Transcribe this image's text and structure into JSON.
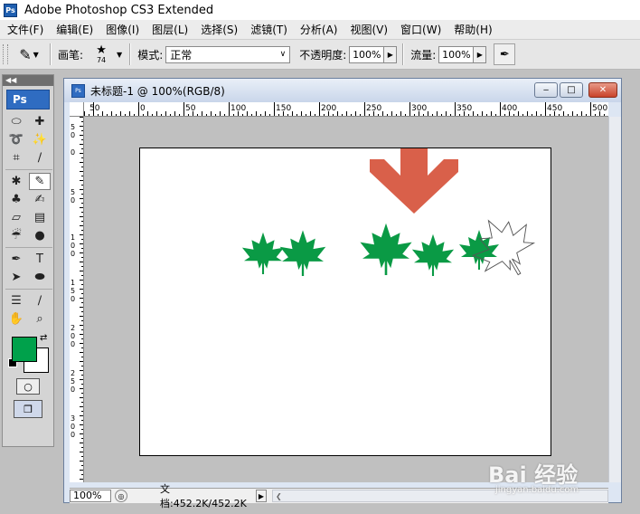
{
  "app": {
    "title": "Adobe Photoshop CS3 Extended",
    "icon_text": "Ps"
  },
  "menu": [
    "文件(F)",
    "编辑(E)",
    "图像(I)",
    "图层(L)",
    "选择(S)",
    "滤镜(T)",
    "分析(A)",
    "视图(V)",
    "窗口(W)",
    "帮助(H)"
  ],
  "options": {
    "brush_label": "画笔:",
    "brush_size": "74",
    "mode_label": "模式:",
    "mode_value": "正常",
    "opacity_label": "不透明度:",
    "opacity_value": "100%",
    "flow_label": "流量:",
    "flow_value": "100%"
  },
  "toolbox": {
    "logo": "Ps",
    "active_tool": "brush-tool"
  },
  "colors": {
    "foreground": "#00a14b",
    "background": "#ffffff",
    "arrow": "#d9604a",
    "leaf": "#0a9a45"
  },
  "document": {
    "title": "未标题-1 @ 100%(RGB/8)",
    "zoom": "100%",
    "doc_info": "文档:452.2K/452.2K"
  },
  "ruler": {
    "h_labels": [
      "50",
      "0",
      "50",
      "100",
      "150",
      "200",
      "250",
      "300",
      "350",
      "400",
      "450",
      "500"
    ],
    "v_labels": [
      "5\n0",
      "0",
      "5\n0",
      "1\n0\n0",
      "1\n5\n0",
      "2\n0\n0",
      "2\n5\n0",
      "3\n0\n0"
    ]
  },
  "watermark": {
    "text": "Bai 经验",
    "sub": "jingyan.baidu.com"
  }
}
